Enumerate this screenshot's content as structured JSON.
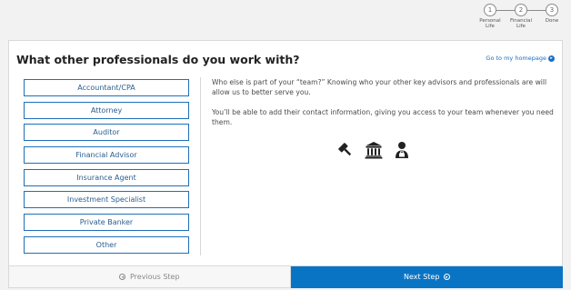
{
  "stepper": {
    "steps": [
      {
        "number": "1",
        "label_line1": "Personal",
        "label_line2": "Life"
      },
      {
        "number": "2",
        "label_line1": "Financial",
        "label_line2": "Life"
      },
      {
        "number": "3",
        "label_line1": "Done",
        "label_line2": ""
      }
    ]
  },
  "header": {
    "title": "What other professionals do you work with?",
    "home_link": "Go to my homepage"
  },
  "professionals": [
    "Accountant/CPA",
    "Attorney",
    "Auditor",
    "Financial Advisor",
    "Insurance Agent",
    "Investment Specialist",
    "Private Banker",
    "Other"
  ],
  "description": {
    "paragraph1": "Who else is part of your “team?” Knowing who your other key advisors and professionals are will allow us to better serve you.",
    "paragraph2": "You’ll be able to add their contact information, giving you access to your team whenever you need them."
  },
  "icons": [
    "gavel-icon",
    "bank-icon",
    "advisor-icon"
  ],
  "nav": {
    "previous_label": "Previous Step",
    "next_label": "Next Step"
  },
  "colors": {
    "accent": "#0a74c4",
    "button_border": "#1f6fb8",
    "button_text": "#2a5d8f"
  }
}
